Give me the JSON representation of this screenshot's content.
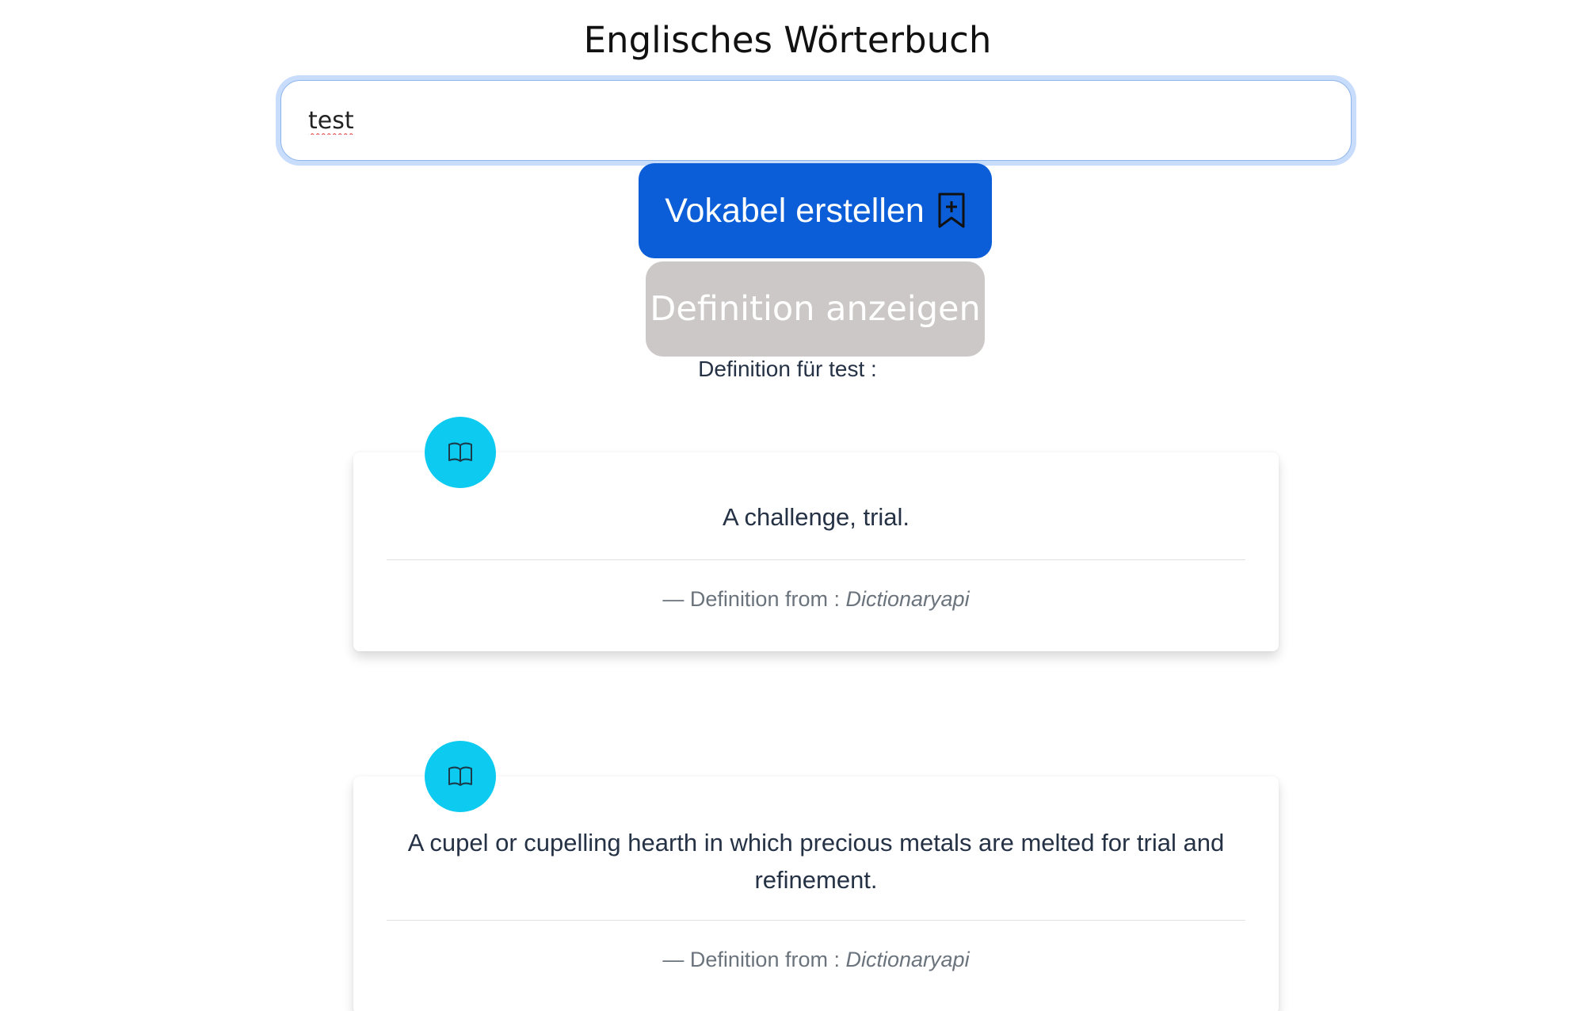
{
  "header": {
    "title": "Englisches Wörterbuch"
  },
  "search": {
    "value": "test"
  },
  "actions": {
    "create_vocab_label": "Vokabel erstellen",
    "create_vocab_icon": "bookmark-plus-icon",
    "show_definition_label": "Definition anzeigen"
  },
  "definitions_heading": "Definition für test :",
  "colors": {
    "primary": "#0b5ed7",
    "secondary": "#cdc8c8",
    "badge": "#0dcaf0",
    "focus_ring": "#c8dcfb"
  },
  "definitions": [
    {
      "icon": "book-icon",
      "text": "A challenge, trial.",
      "source_prefix": "— Definition from :",
      "source": "Dictionaryapi"
    },
    {
      "icon": "book-icon",
      "text": "A cupel or cupelling hearth in which precious metals are melted for trial and refinement.",
      "source_prefix": "— Definition from :",
      "source": "Dictionaryapi"
    }
  ]
}
